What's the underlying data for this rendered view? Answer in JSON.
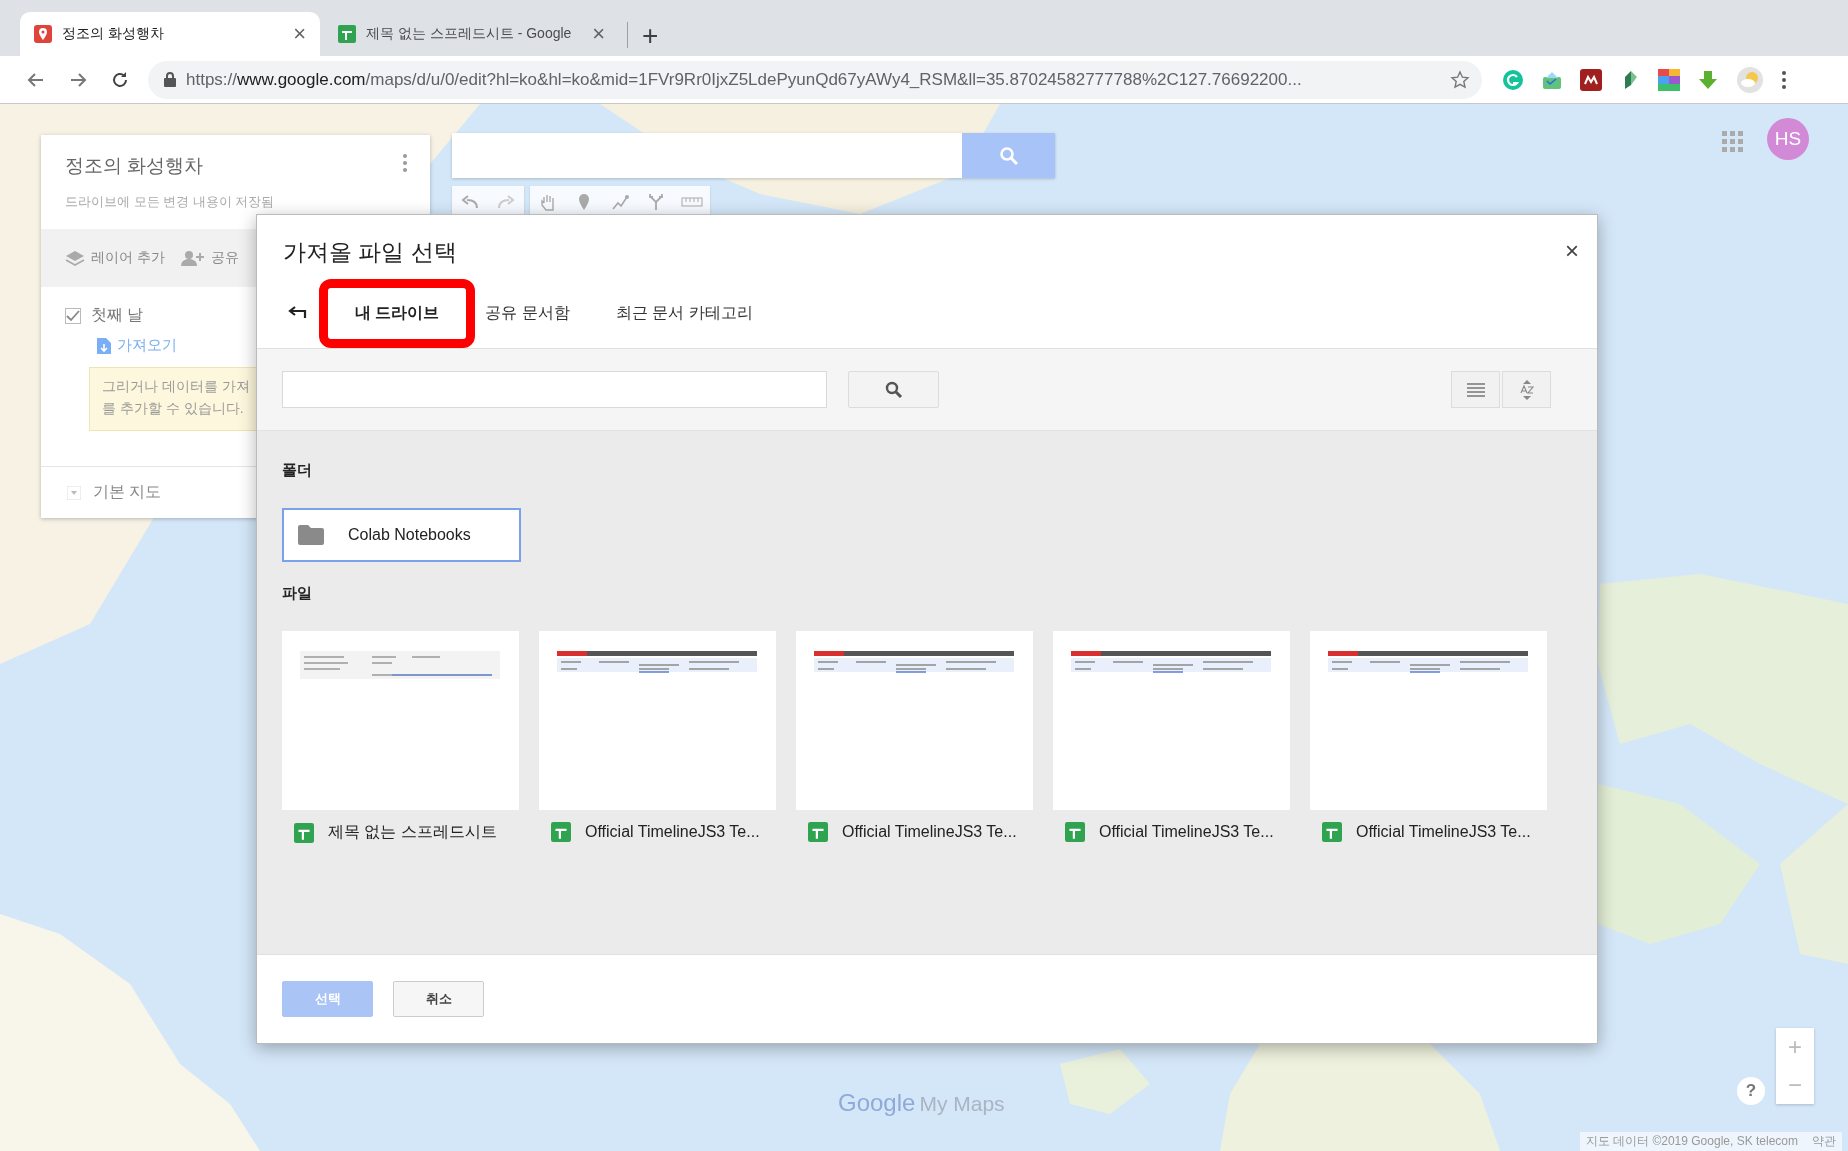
{
  "browser": {
    "tabs": [
      {
        "title": "정조의 화성행차",
        "kind": "maps",
        "selected": true,
        "close": "×"
      },
      {
        "title": "제목 없는 스프레드시트 - Google",
        "kind": "sheets",
        "selected": false,
        "close": "×"
      }
    ],
    "new_tab": "+",
    "url": {
      "scheme": "https://",
      "host": "www.google.com",
      "rest": "/maps/d/u/0/edit?hl=ko&hl=ko&mid=1FVr9Rr0IjxZ5LdePyunQd67yAWy4_RSM&ll=35.87024582777788%2C127.76692200..."
    }
  },
  "maps_panel": {
    "title": "정조의 화성행차",
    "save_status": "드라이브에 모든 변경 내용이 저장됨",
    "toolbar": [
      "레이어 추가",
      "공유"
    ],
    "layers": [
      {
        "name": "첫째 날",
        "checked": true,
        "import_link": "가져오기",
        "tooltip": [
          "그리거나 데이터를 가져",
          "를 추가할 수 있습니다."
        ]
      }
    ],
    "base_map": "기본 지도"
  },
  "account": {
    "initials": "HS"
  },
  "dialog": {
    "title": "가져올 파일 선택",
    "close": "×",
    "tabs": [
      {
        "label": "내 드라이브",
        "selected": true,
        "highlighted": true
      },
      {
        "label": "공유 문서함",
        "selected": false,
        "highlighted": false
      },
      {
        "label": "최근 문서 카테고리",
        "selected": false,
        "highlighted": false
      }
    ],
    "folders_heading": "폴더",
    "folders": [
      {
        "name": "Colab Notebooks",
        "selected": true
      }
    ],
    "files_heading": "파일",
    "files": [
      {
        "name": "제목 없는 스프레드시트",
        "kind": "blank"
      },
      {
        "name": "Official TimelineJS3 Te...",
        "kind": "timeline"
      },
      {
        "name": "Official TimelineJS3 Te...",
        "kind": "timeline"
      },
      {
        "name": "Official TimelineJS3 Te...",
        "kind": "timeline"
      },
      {
        "name": "Official TimelineJS3 Te...",
        "kind": "timeline"
      }
    ],
    "buttons": [
      {
        "label": "선택",
        "kind": "primary",
        "disabled": true
      },
      {
        "label": "취소",
        "kind": "secondary",
        "disabled": false
      }
    ]
  },
  "map": {
    "logo_brand": "Google",
    "logo_product": "My Maps",
    "attribution": "지도 데이터 ©2019 Google, SK telecom",
    "terms": "약관",
    "zoom_in": "+",
    "zoom_out": "−",
    "help": "?"
  }
}
